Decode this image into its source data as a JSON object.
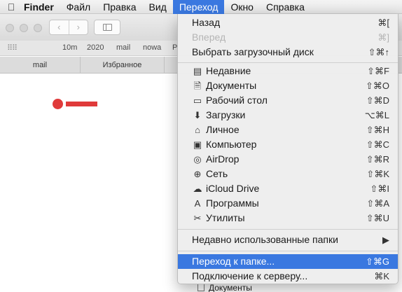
{
  "menubar": {
    "apple_icon": "apple-logo-icon",
    "items": [
      "Finder",
      "Файл",
      "Правка",
      "Вид",
      "Переход",
      "Окно",
      "Справка"
    ],
    "active_index": 4
  },
  "window": {
    "nav_back": "‹",
    "nav_forward": "›",
    "favorites": [
      "10m",
      "2020",
      "mail",
      "nowa",
      "P"
    ],
    "tabs": [
      "mail",
      "Избранное"
    ],
    "peek_item": "Документы"
  },
  "menu": {
    "top": [
      {
        "label": "Назад",
        "shortcut": "⌘[",
        "enabled": true
      },
      {
        "label": "Вперед",
        "shortcut": "⌘]",
        "enabled": false
      },
      {
        "label": "Выбрать загрузочный диск",
        "shortcut": "⇧⌘↑",
        "enabled": true
      }
    ],
    "places": [
      {
        "label": "Недавние",
        "shortcut": "⇧⌘F",
        "icon": "recents-icon",
        "glyph": "▤"
      },
      {
        "label": "Документы",
        "shortcut": "⇧⌘O",
        "icon": "documents-icon",
        "glyph": "🗎"
      },
      {
        "label": "Рабочий стол",
        "shortcut": "⇧⌘D",
        "icon": "desktop-icon",
        "glyph": "▭"
      },
      {
        "label": "Загрузки",
        "shortcut": "⌥⌘L",
        "icon": "downloads-icon",
        "glyph": "⬇"
      },
      {
        "label": "Личное",
        "shortcut": "⇧⌘H",
        "icon": "home-icon",
        "glyph": "⌂"
      },
      {
        "label": "Компьютер",
        "shortcut": "⇧⌘C",
        "icon": "computer-icon",
        "glyph": "▣"
      },
      {
        "label": "AirDrop",
        "shortcut": "⇧⌘R",
        "icon": "airdrop-icon",
        "glyph": "◎"
      },
      {
        "label": "Сеть",
        "shortcut": "⇧⌘K",
        "icon": "network-icon",
        "glyph": "⊕"
      },
      {
        "label": "iCloud Drive",
        "shortcut": "⇧⌘I",
        "icon": "icloud-icon",
        "glyph": "☁"
      },
      {
        "label": "Программы",
        "shortcut": "⇧⌘A",
        "icon": "applications-icon",
        "glyph": "A"
      },
      {
        "label": "Утилиты",
        "shortcut": "⇧⌘U",
        "icon": "utilities-icon",
        "glyph": "✂"
      }
    ],
    "recent_folders": {
      "label": "Недавно использованные папки",
      "arrow": "▶"
    },
    "bottom": [
      {
        "label": "Переход к папке...",
        "shortcut": "⇧⌘G",
        "highlighted": true
      },
      {
        "label": "Подключение к серверу...",
        "shortcut": "⌘K",
        "highlighted": false
      }
    ]
  },
  "colors": {
    "accent": "#3a78e0",
    "red_marker": "#e03a3a"
  }
}
